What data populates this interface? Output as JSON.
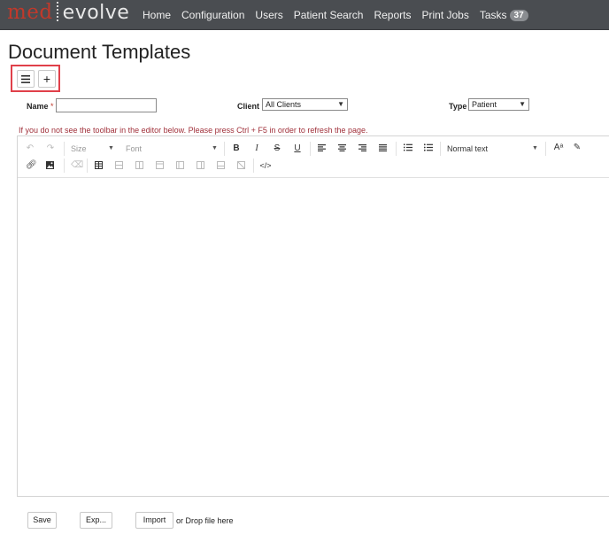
{
  "app": {
    "logo_part1": "med",
    "logo_part2": "evolve"
  },
  "nav": {
    "home": "Home",
    "configuration": "Configuration",
    "users": "Users",
    "patient_search": "Patient Search",
    "reports": "Reports",
    "print_jobs": "Print Jobs",
    "tasks": "Tasks",
    "tasks_count": "37"
  },
  "page": {
    "title": "Document Templates",
    "menu_icon": "≡",
    "add_icon": "+"
  },
  "form": {
    "name_label": "Name",
    "required_marker": "*",
    "name_value": "",
    "client_label": "Client",
    "client_value": "All Clients",
    "type_label": "Type",
    "type_value": "Patient"
  },
  "editor": {
    "warning": "If you do not see the toolbar in the editor below. Please press Ctrl + F5 in order to refresh the page.",
    "size_placeholder": "Size",
    "font_placeholder": "Font",
    "bold": "B",
    "italic": "I",
    "strike": "S",
    "underline": "U",
    "paragraph_style": "Normal text",
    "font_size_icon": "Aᵃ"
  },
  "footer": {
    "save": "Save",
    "export": "Exp...",
    "import": "Import",
    "drop_hint": "or Drop file here"
  },
  "colors": {
    "navbar_bg": "#4a4d51",
    "logo_red": "#c0392b",
    "highlight": "#e0404a",
    "warning": "#a0303a"
  }
}
